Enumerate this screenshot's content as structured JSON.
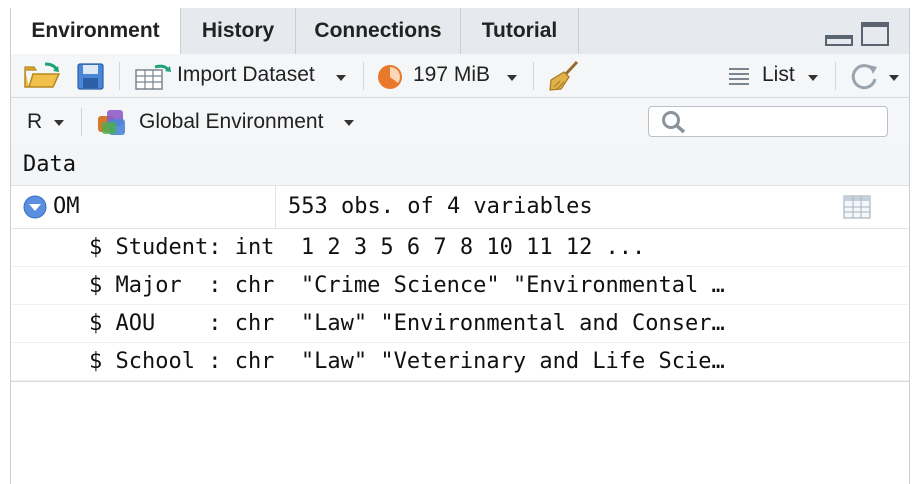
{
  "tabs": [
    {
      "label": "Environment",
      "active": true
    },
    {
      "label": "History",
      "active": false
    },
    {
      "label": "Connections",
      "active": false
    },
    {
      "label": "Tutorial",
      "active": false
    }
  ],
  "toolbar": {
    "import_label": "Import Dataset",
    "memory_label": "197 MiB",
    "view_label": "List"
  },
  "toolbar2": {
    "language_label": "R",
    "environment_label": "Global Environment",
    "search_placeholder": ""
  },
  "data_section": {
    "header": "Data",
    "object": {
      "name": "OM",
      "value": "553 obs. of 4 variables"
    },
    "structure": [
      "$ Student: int  1 2 3 5 6 7 8 10 11 12 ...",
      "$ Major  : chr  \"Crime Science\" \"Environmental …",
      "$ AOU    : chr  \"Law\" \"Environmental and Conser…",
      "$ School : chr  \"Law\" \"Veterinary and Life Scie…"
    ]
  },
  "colors": {
    "tab_bar": "#e6e9ed",
    "toolbar": "#f4f6f8",
    "accent_blue": "#4a86d8",
    "memory_orange": "#e8792b"
  },
  "icons": [
    "open-folder-icon",
    "save-icon",
    "import-dataset-icon",
    "memory-usage-icon",
    "broom-icon",
    "list-icon",
    "refresh-icon",
    "r-language-icon",
    "global-environment-icon",
    "search-icon",
    "expand-icon",
    "table-view-icon",
    "minimize-icon",
    "maximize-icon"
  ]
}
